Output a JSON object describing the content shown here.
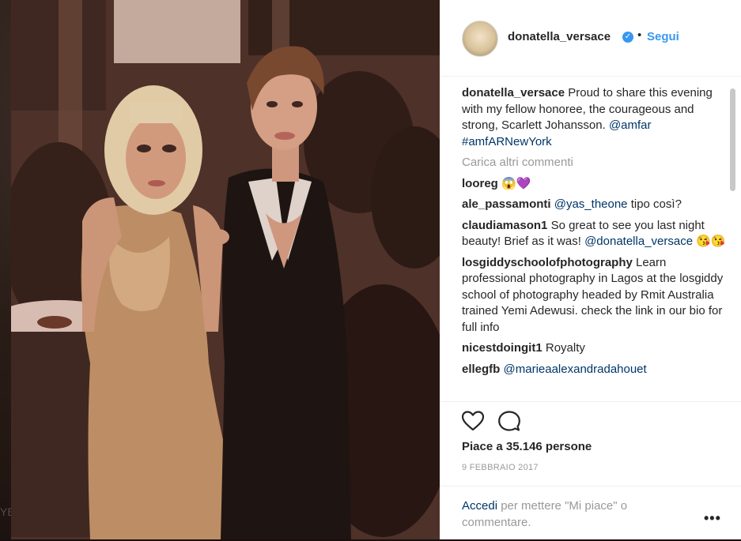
{
  "backdrop": {
    "side_text": "YE"
  },
  "post": {
    "username": "donatella_versace",
    "verified_icon": "verified-badge-icon",
    "separator": "•",
    "follow_label": "Segui",
    "caption_user": "donatella_versace",
    "caption_text": "Proud to share this evening with my fellow honoree, the courageous and strong, Scarlett Johansson.",
    "caption_mention": "@amfar",
    "caption_hashtag": "#amfARNewYork",
    "load_more": "Carica altri commenti",
    "comments": [
      {
        "user": "looreg",
        "text": "😱💜",
        "mention": ""
      },
      {
        "user": "ale_passamonti",
        "text": "tipo così?",
        "mention": "@yas_theone"
      },
      {
        "user": "claudiamason1",
        "text": "So great to see you last night beauty! Brief as it was!",
        "mention": "@donatella_versace",
        "emoji": "😘😘"
      },
      {
        "user": "losgiddyschoolofphotography",
        "text": "Learn professional photography in Lagos at the losgiddy school of photography headed by Rmit Australia trained Yemi Adewusi. check the link in our bio for full info",
        "mention": ""
      },
      {
        "user": "nicestdoingit1",
        "text": "Royalty",
        "mention": ""
      },
      {
        "user": "ellegfb",
        "text": "",
        "mention": "@marieaalexandradahouet"
      }
    ],
    "likes": "Piace a 35.146 persone",
    "date": "9 FEBBRAIO 2017",
    "login_link": "Accedi",
    "login_text": "per mettere \"Mi piace\" o commentare.",
    "more_label": "•••"
  }
}
